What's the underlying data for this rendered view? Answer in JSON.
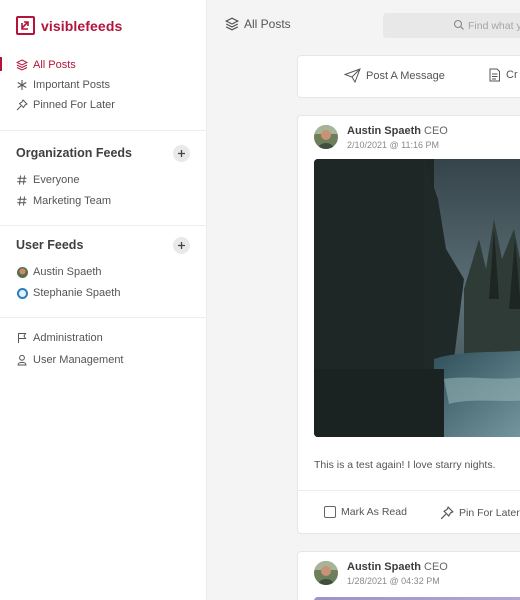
{
  "brand": {
    "name": "visiblefeeds",
    "color": "#b3153a"
  },
  "nav": {
    "main": [
      {
        "label": "All Posts",
        "icon": "layers-icon",
        "active": true
      },
      {
        "label": "Important Posts",
        "icon": "asterisk-icon"
      },
      {
        "label": "Pinned For Later",
        "icon": "pin-icon"
      }
    ],
    "organization_feeds": {
      "title": "Organization Feeds",
      "items": [
        {
          "label": "Everyone",
          "icon": "hash-icon"
        },
        {
          "label": "Marketing Team",
          "icon": "hash-icon"
        }
      ]
    },
    "user_feeds": {
      "title": "User Feeds",
      "items": [
        {
          "label": "Austin Spaeth",
          "icon": "avatar"
        },
        {
          "label": "Stephanie Spaeth",
          "icon": "avatar"
        }
      ]
    },
    "admin": [
      {
        "label": "Administration",
        "icon": "flag-icon"
      },
      {
        "label": "User Management",
        "icon": "user-icon"
      }
    ]
  },
  "topbar": {
    "title": "All Posts",
    "search_placeholder": "Find what you"
  },
  "composer": {
    "post_label": "Post A Message",
    "create_label": "Cr"
  },
  "posts": [
    {
      "author": "Austin Spaeth",
      "role": "CEO",
      "timestamp": "2/10/2021 @ 11:16 PM",
      "text": "This is a test again! I love starry nights.",
      "actions": {
        "mark_read": "Mark As Read",
        "pin": "Pin For Later"
      }
    },
    {
      "author": "Austin Spaeth",
      "role": "CEO",
      "timestamp": "1/28/2021 @ 04:32 PM"
    }
  ]
}
